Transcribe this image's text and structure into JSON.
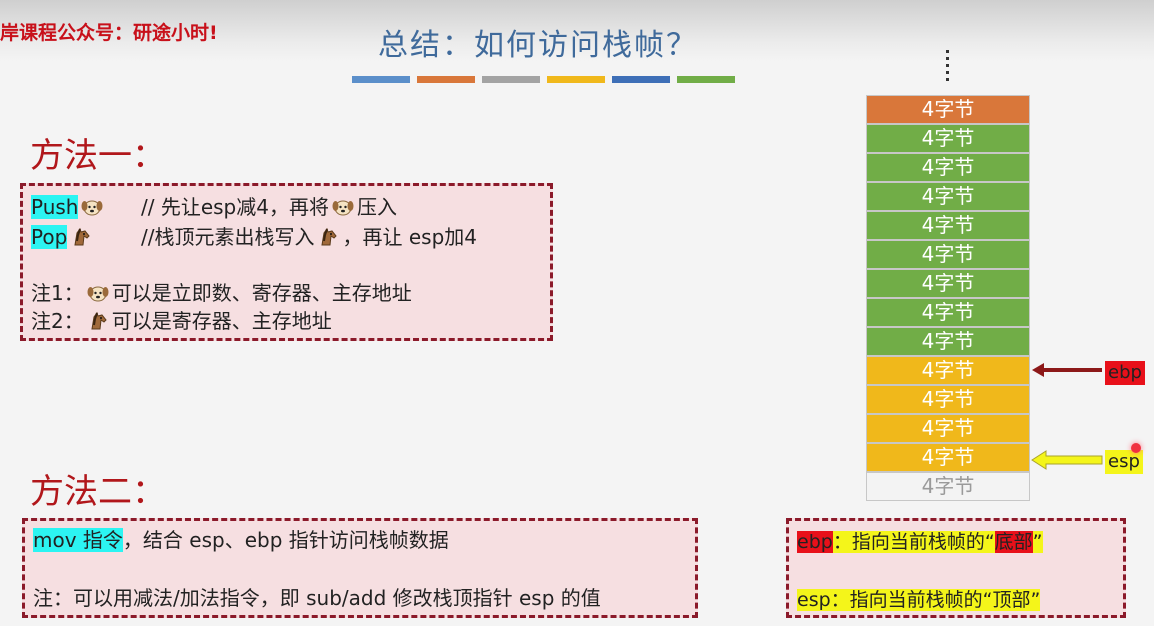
{
  "watermark": "岸课程公众号：研途小时!",
  "title": "总结：如何访问栈帧？",
  "color_bars": [
    "#5b8fca",
    "#d9773a",
    "#a3a3a3",
    "#f0b81b",
    "#3e6fb7",
    "#71ad47"
  ],
  "method1": {
    "heading": "方法一：",
    "push_label": "Push",
    "push_comment_a": "// 先让esp减4，再将",
    "push_comment_b": "压入",
    "pop_label": "Pop",
    "pop_comment_a": "//栈顶元素出栈写入",
    "pop_comment_b": "，再让 esp加4",
    "note1_a": "注1：",
    "note1_b": "可以是立即数、寄存器、主存地址",
    "note2_a": "注2：",
    "note2_b": "可以是寄存器、主存地址",
    "icons": [
      "dog-icon",
      "horse-icon"
    ]
  },
  "method2": {
    "heading": "方法二：",
    "mov_label": "mov 指令",
    "mov_text": "，结合 esp、ebp 指针访问栈帧数据",
    "note": "注：可以用减法/加法指令，即 sub/add 修改栈顶指针 esp 的值"
  },
  "stack": {
    "cell_label": "4字节",
    "colors": [
      "orange",
      "green",
      "green",
      "green",
      "green",
      "green",
      "green",
      "green",
      "green",
      "yellow",
      "yellow",
      "yellow",
      "yellow",
      "white"
    ],
    "ebp_label": "ebp",
    "esp_label": "esp",
    "ebp_color": "#e8101a",
    "esp_color": "#f4f51a"
  },
  "legend": {
    "ebp_reg": "ebp",
    "ebp_text_a": "：指向当前栈帧的“",
    "ebp_text_hl": "底部",
    "ebp_text_b": "”",
    "esp_text": "esp：指向当前栈帧的“顶部”"
  }
}
